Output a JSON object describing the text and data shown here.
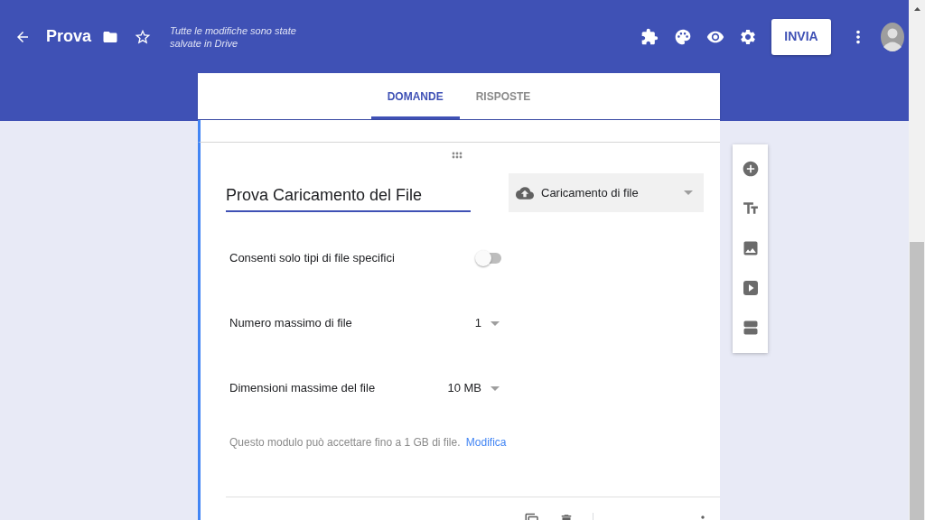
{
  "header": {
    "title": "Prova",
    "save_status": "Tutte le modifiche sono state salvate in Drive",
    "send_button": "INVIA"
  },
  "tabs": [
    {
      "label": "DOMANDE",
      "selected": true
    },
    {
      "label": "RISPOSTE",
      "selected": false
    }
  ],
  "question": {
    "title": "Prova Caricamento del File",
    "type": "Caricamento di file",
    "settings": [
      {
        "kind": "toggle",
        "label": "Consenti solo tipi di file specifici",
        "on": false
      },
      {
        "kind": "select",
        "label": "Numero massimo di file",
        "value": "1"
      },
      {
        "kind": "select",
        "label": "Dimensioni massime del file",
        "value": "10 MB"
      }
    ],
    "note": "Questo modulo può accettare fino a 1 GB di file.",
    "note_link": "Modifica"
  }
}
